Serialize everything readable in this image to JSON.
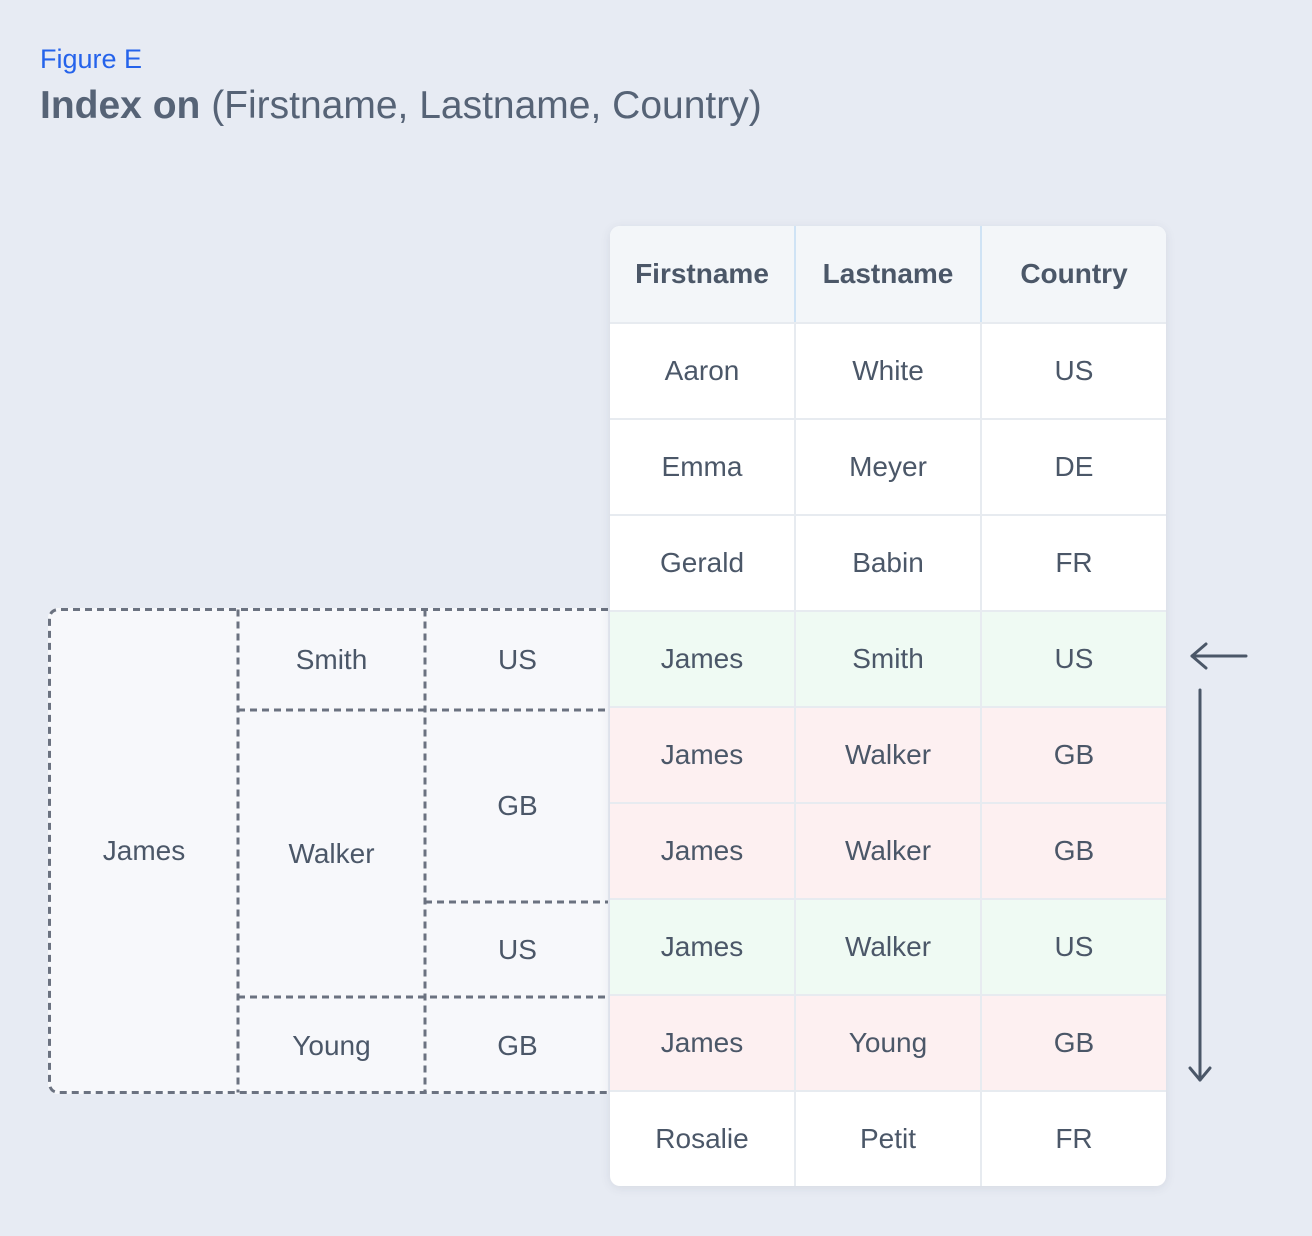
{
  "figure_label": "Figure E",
  "title": {
    "bold": "Index on",
    "rest": "(Firstname, Lastname, Country)"
  },
  "tree": {
    "firstname": "James",
    "lastnames": [
      "Smith",
      "Walker",
      "Young"
    ],
    "countries": [
      "US",
      "GB",
      "US",
      "GB"
    ]
  },
  "table": {
    "headers": [
      "Firstname",
      "Lastname",
      "Country"
    ],
    "rows": [
      {
        "firstname": "Aaron",
        "lastname": "White",
        "country": "US",
        "highlight": "none"
      },
      {
        "firstname": "Emma",
        "lastname": "Meyer",
        "country": "DE",
        "highlight": "none"
      },
      {
        "firstname": "Gerald",
        "lastname": "Babin",
        "country": "FR",
        "highlight": "none"
      },
      {
        "firstname": "James",
        "lastname": "Smith",
        "country": "US",
        "highlight": "green"
      },
      {
        "firstname": "James",
        "lastname": "Walker",
        "country": "GB",
        "highlight": "red"
      },
      {
        "firstname": "James",
        "lastname": "Walker",
        "country": "GB",
        "highlight": "red"
      },
      {
        "firstname": "James",
        "lastname": "Walker",
        "country": "US",
        "highlight": "green"
      },
      {
        "firstname": "James",
        "lastname": "Young",
        "country": "GB",
        "highlight": "red"
      },
      {
        "firstname": "Rosalie",
        "lastname": "Petit",
        "country": "FR",
        "highlight": "none"
      }
    ]
  },
  "colors": {
    "background": "#e7ebf3",
    "accent": "#2563eb",
    "match_row": "#effaf3",
    "nonmatch_row": "#fdf0f1",
    "dash": "#6b7280"
  },
  "icons": [
    "arrow-left-icon",
    "arrow-down-icon"
  ]
}
